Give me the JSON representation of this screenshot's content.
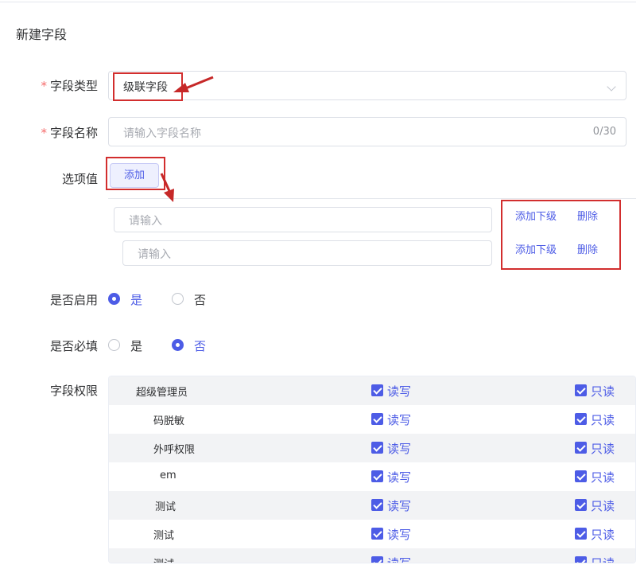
{
  "page": {
    "title": "新建字段"
  },
  "form": {
    "field_type": {
      "label": "字段类型",
      "required_mark": "*",
      "value": "级联字段",
      "icon": "chevron-down-icon"
    },
    "field_name": {
      "label": "字段名称",
      "required_mark": "*",
      "placeholder": "请输入字段名称",
      "counter": "0/30"
    },
    "options": {
      "label": "选项值",
      "add_label": "添加",
      "items": [
        {
          "placeholder": "请输入",
          "add_child_label": "添加下级",
          "delete_label": "删除"
        },
        {
          "placeholder": "请输入",
          "add_child_label": "添加下级",
          "delete_label": "删除"
        }
      ]
    },
    "enabled": {
      "label": "是否启用",
      "yes": "是",
      "no": "否",
      "selected": "是"
    },
    "required": {
      "label": "是否必填",
      "yes": "是",
      "no": "否",
      "selected": "否"
    },
    "permissions": {
      "label": "字段权限",
      "rows": [
        {
          "name": "超级管理员",
          "read_write": "读写",
          "read_only": "只读"
        },
        {
          "name": "码脱敏",
          "read_write": "读写",
          "read_only": "只读"
        },
        {
          "name": "外呼权限",
          "read_write": "读写",
          "read_only": "只读"
        },
        {
          "name": "em",
          "read_write": "读写",
          "read_only": "只读"
        },
        {
          "name": "测试",
          "read_write": "读写",
          "read_only": "只读"
        },
        {
          "name": "测试",
          "read_write": "读写",
          "read_only": "只读"
        },
        {
          "name": "测试",
          "read_write": "读写",
          "read_only": "只读"
        }
      ]
    }
  },
  "colors": {
    "accent": "#4d5ce6",
    "annotation": "#d22e2e",
    "required": "#f56c6c"
  }
}
